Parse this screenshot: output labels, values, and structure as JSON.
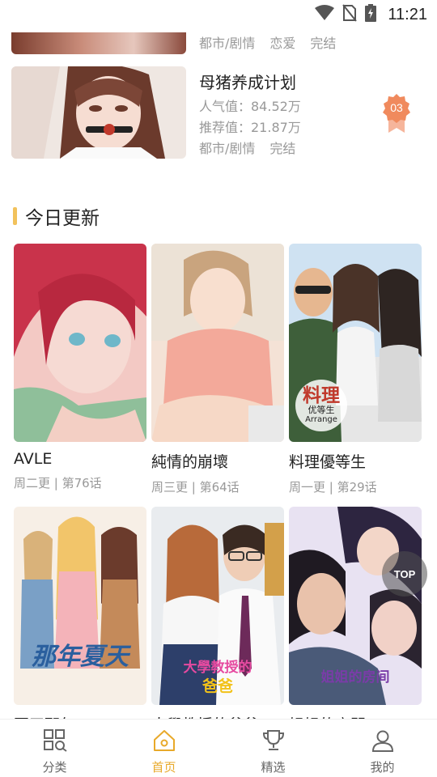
{
  "status_bar": {
    "time": "11:21"
  },
  "ranking": {
    "prev_item_tags": [
      "都市/剧情",
      "恋爱",
      "完结"
    ],
    "item": {
      "title": "母猪养成计划",
      "popularity": "人气值：84.52万",
      "recommend": "推荐值：21.87万",
      "genre": "都市/剧情",
      "status": "完结",
      "rank_badge": "03"
    }
  },
  "section": {
    "title": "今日更新"
  },
  "comics": [
    {
      "title": "AVLE",
      "update": "周二更 | 第76话",
      "palette": [
        "#f3c9c4",
        "#c9334b",
        "#8fbf9a"
      ]
    },
    {
      "title": "純情的崩壞",
      "update": "周三更 | 第64话",
      "palette": [
        "#f4e2d6",
        "#d8b28f",
        "#ecd6c3"
      ]
    },
    {
      "title": "料理優等生",
      "update": "周一更 | 第29话",
      "palette": [
        "#cfe2f2",
        "#f1d7c5",
        "#3e5f3a"
      ],
      "cover_text": [
        "料理",
        "优等生",
        "Arrange"
      ]
    },
    {
      "title": "夏天那年",
      "update": "",
      "palette": [
        "#f7efe6",
        "#f2c56a",
        "#c48a5a"
      ],
      "cover_text": [
        "那年夏天"
      ]
    },
    {
      "title": "大學教授的爸爸",
      "update": "",
      "palette": [
        "#e9ecef",
        "#2d3f6a",
        "#f2d2c0"
      ],
      "cover_text": [
        "大學教授的",
        "爸爸"
      ]
    },
    {
      "title": "姐姐的房間",
      "update": "",
      "palette": [
        "#e8e2f2",
        "#2d2540",
        "#f1d1c7"
      ],
      "cover_text": [
        "姐姐的房间"
      ]
    }
  ],
  "top_button": "TOP",
  "bottom_nav": [
    {
      "label": "分类",
      "icon": "category-grid-icon",
      "active": false
    },
    {
      "label": "首页",
      "icon": "home-icon",
      "active": true
    },
    {
      "label": "精选",
      "icon": "trophy-icon",
      "active": false
    },
    {
      "label": "我的",
      "icon": "user-icon",
      "active": false
    }
  ],
  "colors": {
    "accent": "#e8a92a",
    "section_bar": "#f2c25c",
    "badge": "#f08a5d",
    "muted_text": "#999999"
  }
}
